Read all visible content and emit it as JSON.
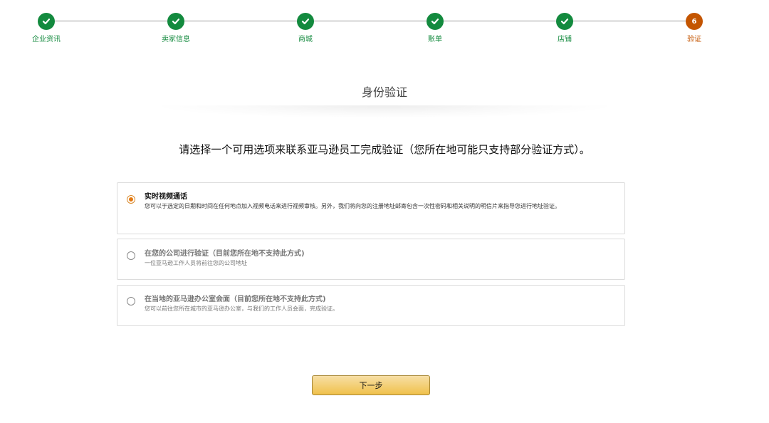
{
  "stepper": {
    "steps": [
      {
        "label": "企业资讯",
        "state": "done"
      },
      {
        "label": "卖家信息",
        "state": "done"
      },
      {
        "label": "商城",
        "state": "done"
      },
      {
        "label": "账单",
        "state": "done"
      },
      {
        "label": "店铺",
        "state": "done"
      },
      {
        "label": "验证",
        "state": "current",
        "number": "6"
      }
    ],
    "done_icon": "checkmark-icon",
    "colors": {
      "done": "#138a3e",
      "current": "#c45500"
    }
  },
  "page": {
    "title": "身份验证",
    "instruction": "请选择一个可用选项来联系亚马逊员工完成验证（您所在地可能只支持部分验证方式）。"
  },
  "options": [
    {
      "title": "实时视频通话",
      "description": "您可以于选定的日期和时间在任何地点加入视频电话来进行视频审核。另外，我们将向您的注册地址邮寄包含一次性密码和相关说明的明信片来指导您进行地址验证。",
      "selected": true,
      "enabled": true
    },
    {
      "title": "在您的公司进行验证（目前您所在地不支持此方式)",
      "description": "一位亚马逊工作人员将前往您的公司地址",
      "selected": false,
      "enabled": false
    },
    {
      "title": "在当地的亚马逊办公室会面（目前您所在地不支持此方式)",
      "description": "您可以前往您所在城市的亚马逊办公室，与我们的工作人员会面，完成验证。",
      "selected": false,
      "enabled": false
    }
  ],
  "actions": {
    "next_label": "下一步",
    "button_color": "#f0c14b"
  }
}
